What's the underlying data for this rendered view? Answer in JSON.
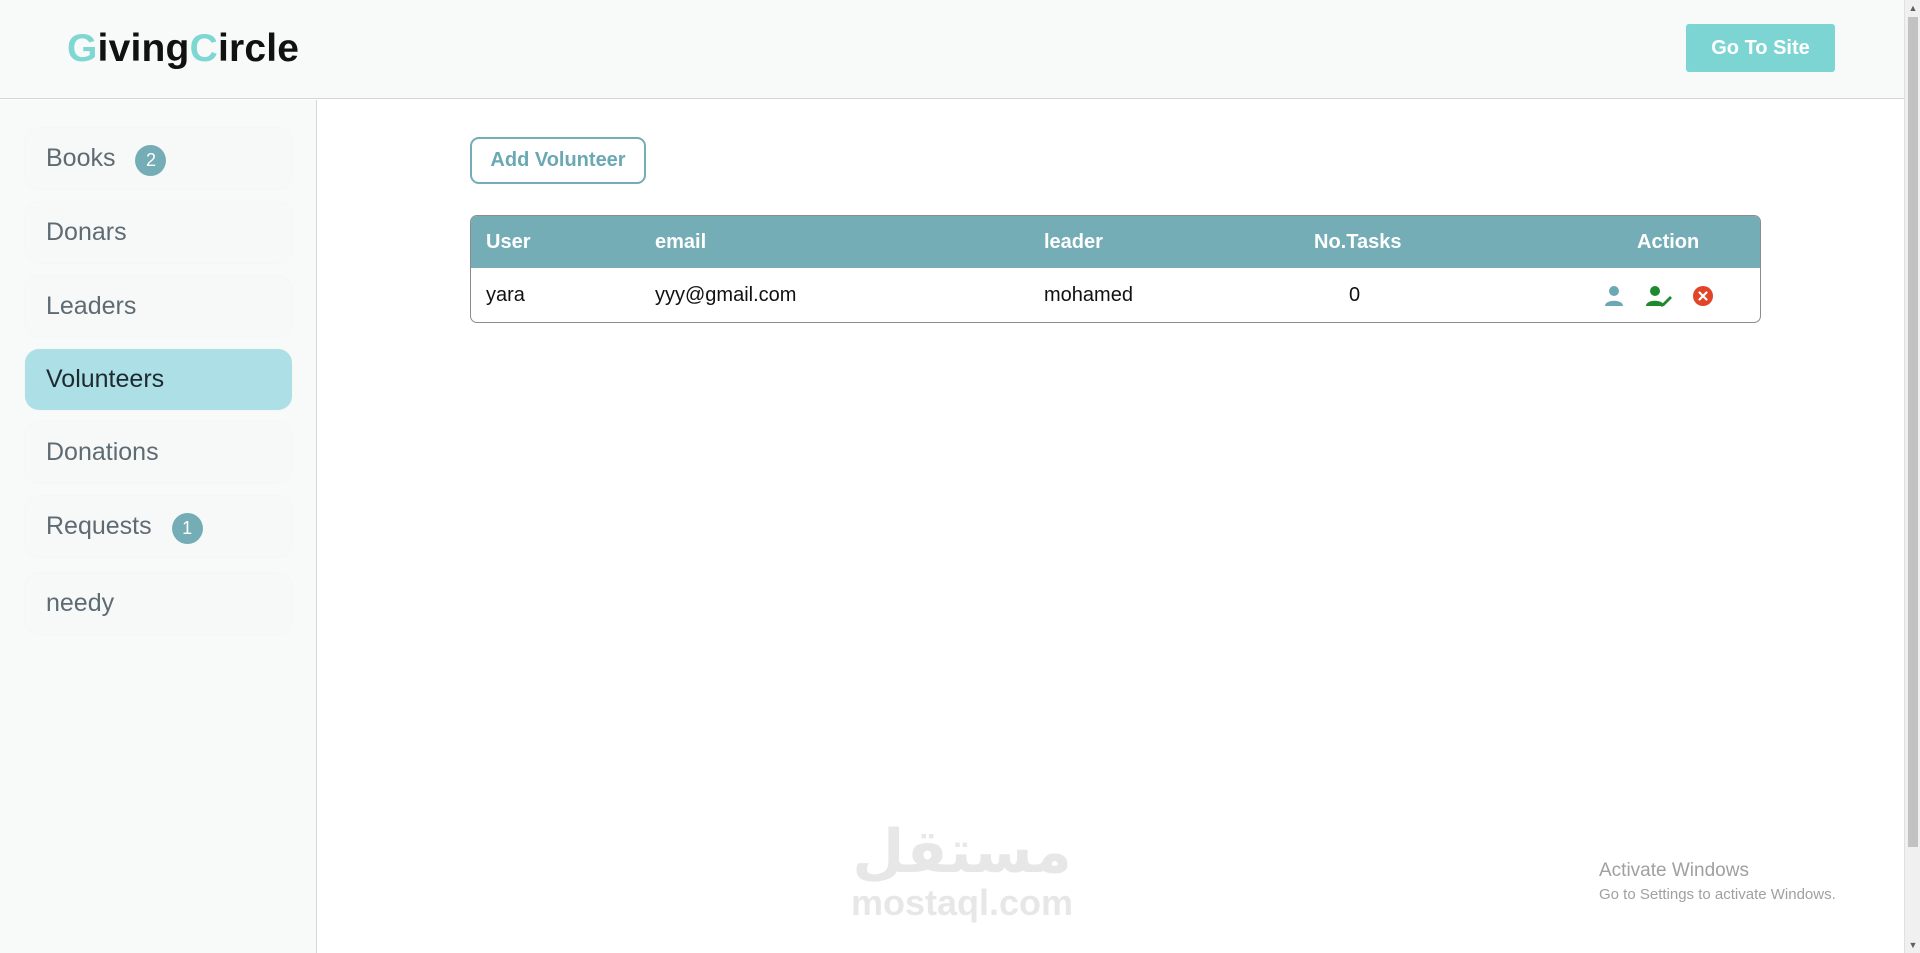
{
  "header": {
    "logo": {
      "first_initial": "G",
      "first_rest": "iving",
      "second_initial": "C",
      "second_rest": "ircle"
    },
    "go_to_site_label": "Go To Site"
  },
  "sidebar": {
    "items": [
      {
        "label": "Books",
        "badge": "2",
        "active": false
      },
      {
        "label": "Donars",
        "badge": null,
        "active": false
      },
      {
        "label": "Leaders",
        "badge": null,
        "active": false
      },
      {
        "label": "Volunteers",
        "badge": null,
        "active": true
      },
      {
        "label": "Donations",
        "badge": null,
        "active": false
      },
      {
        "label": "Requests",
        "badge": "1",
        "active": false
      },
      {
        "label": "needy",
        "badge": null,
        "active": false
      }
    ]
  },
  "main": {
    "add_button_label": "Add Volunteer",
    "table": {
      "headers": {
        "user": "User",
        "email": "email",
        "leader": "leader",
        "tasks": "No.Tasks",
        "action": "Action"
      },
      "rows": [
        {
          "user": "yara",
          "email": "yyy@gmail.com",
          "leader": "mohamed",
          "tasks": "0"
        }
      ]
    }
  },
  "watermark": {
    "arabic": "مستقل",
    "latin": "mostaql.com"
  },
  "os_notice": {
    "title": "Activate Windows",
    "subtitle": "Go to Settings to activate Windows."
  },
  "colors": {
    "accent": "#7dd5d3",
    "table_header": "#75adb7",
    "active_nav": "#acdfe6",
    "view_icon": "#6aa9b3",
    "edit_icon": "#1e8a2e",
    "delete_icon": "#e0452a"
  },
  "icons": {
    "view": "user-icon",
    "edit": "user-edit-icon",
    "delete": "close-circle-icon"
  }
}
